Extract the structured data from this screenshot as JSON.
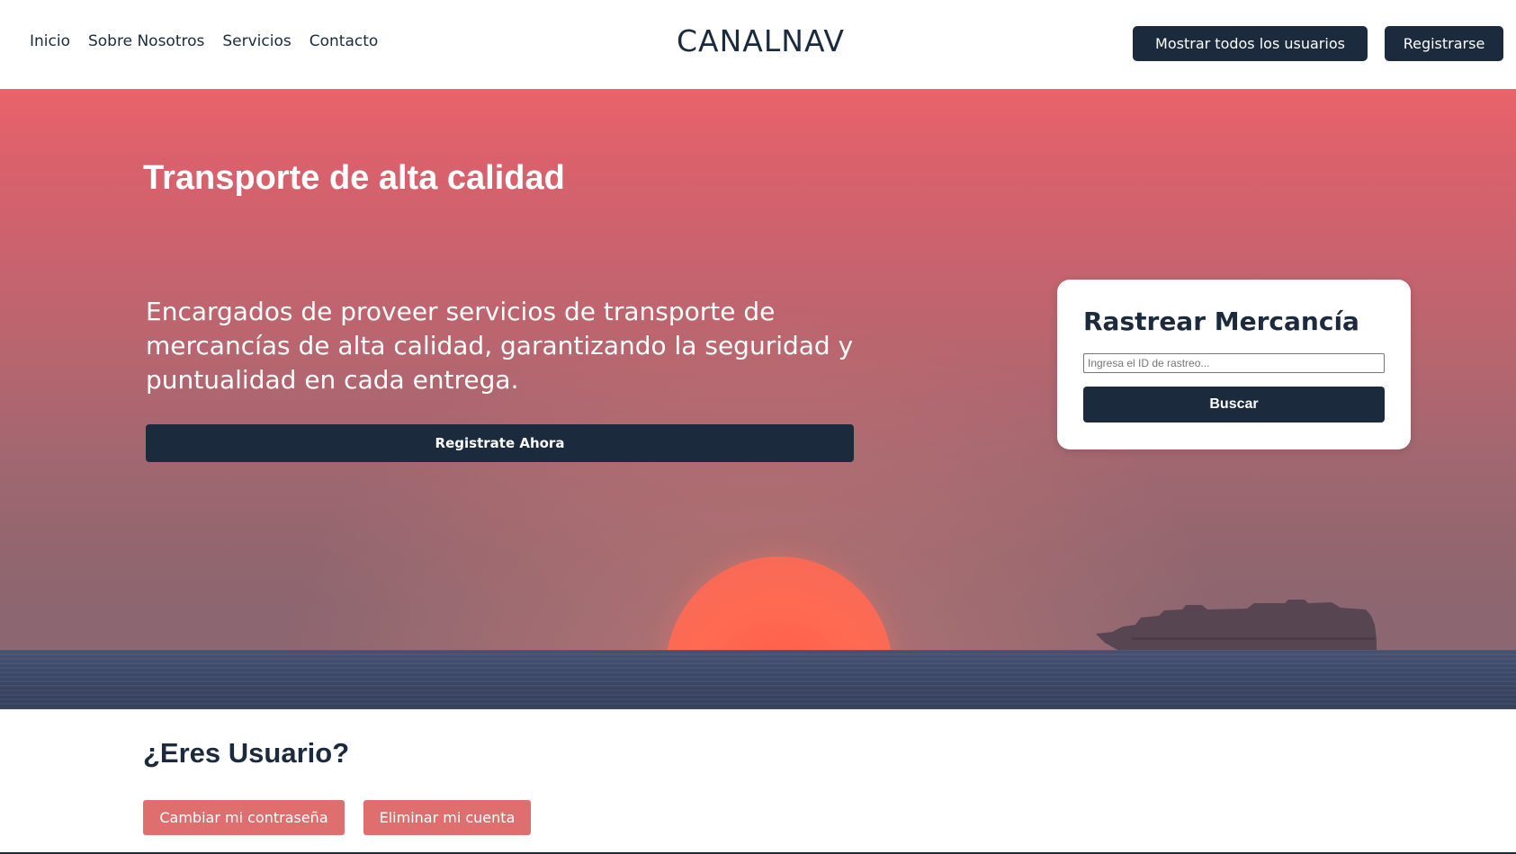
{
  "header": {
    "nav": [
      {
        "label": "Inicio"
      },
      {
        "label": "Sobre Nosotros"
      },
      {
        "label": "Servicios"
      },
      {
        "label": "Contacto"
      }
    ],
    "brand": "CANALNAV",
    "show_users_label": "Mostrar todos los usuarios",
    "register_label": "Registrarse"
  },
  "hero": {
    "title": "Transporte de alta calidad",
    "description": "Encargados de proveer servicios de transporte de mercancías de alta calidad, garantizando la seguridad y puntualidad en cada entrega.",
    "cta_label": "Registrate Ahora"
  },
  "tracking": {
    "title": "Rastrear Mercancía",
    "placeholder": "Ingresa el ID de rastreo...",
    "value": "",
    "search_label": "Buscar"
  },
  "user_section": {
    "title": "¿Eres Usuario?",
    "change_password_label": "Cambiar mi contraseña",
    "delete_account_label": "Eliminar mi cuenta"
  },
  "colors": {
    "primary_dark": "#1b2a3d",
    "accent_red": "#df6f6f",
    "white": "#ffffff"
  }
}
